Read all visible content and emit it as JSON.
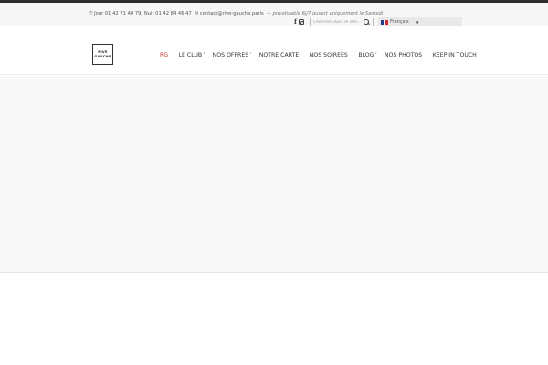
{
  "topbar": {
    "phone_icon": "phone-icon",
    "phones": "Jour 01 42 71 40 79/ Nuit 01 42 84 46 47",
    "email_icon": "envelope-icon",
    "email": "contact@rive-gauche.paris",
    "tagline": "— privatisable 6j/7 ouvert uniquement le Samedi"
  },
  "social": {
    "facebook": "f",
    "instagram_icon": "instagram-icon"
  },
  "search": {
    "placeholder": "Chercher dans le site..."
  },
  "language": {
    "label": "Français",
    "flag_colors": [
      "#1f3c8f",
      "#ffffff",
      "#d1262d"
    ]
  },
  "logo": {
    "line1": "RIVE",
    "line2": "GAUCHE"
  },
  "nav": {
    "items": [
      {
        "label": "RG",
        "active": true
      },
      {
        "label": "LE CLUB",
        "has_submenu": true
      },
      {
        "label": "NOS OFFRES",
        "has_submenu": true
      },
      {
        "label": "NOTRE CARTE"
      },
      {
        "label": "NOS SOIREES"
      },
      {
        "label": "BLOG",
        "has_submenu": true
      },
      {
        "label": "NOS PHOTOS"
      },
      {
        "label": "KEEP IN TOUCH"
      }
    ],
    "accent_color": "#c0392b"
  }
}
